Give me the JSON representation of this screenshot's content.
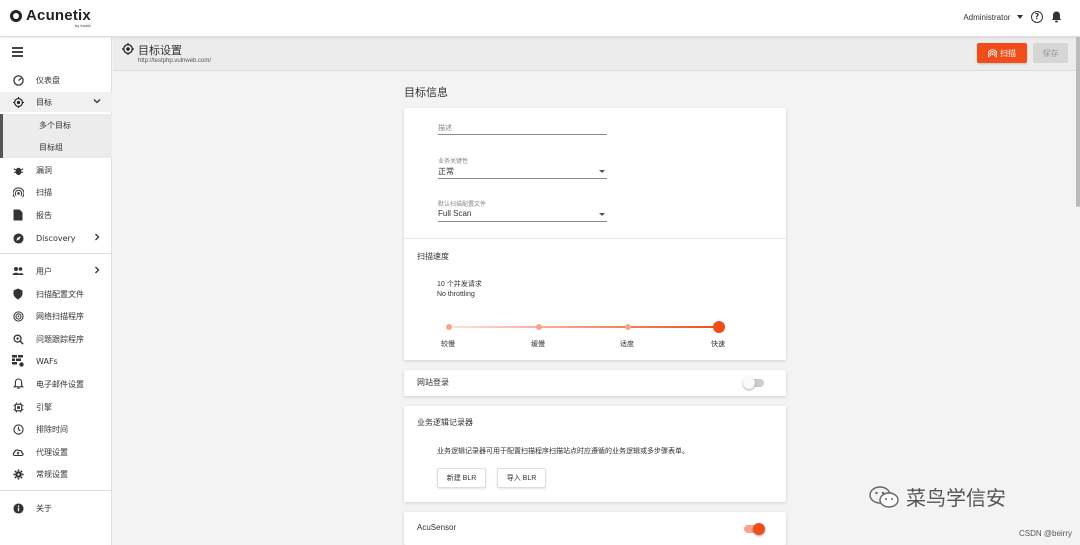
{
  "app": {
    "name": "Acunetix",
    "byline": "by Invicti"
  },
  "header": {
    "user": "Administrator"
  },
  "sidebar": {
    "items": [
      {
        "label": "仪表盘",
        "icon": "dashboard-icon"
      },
      {
        "label": "目标",
        "icon": "target-icon"
      },
      {
        "label": "漏洞",
        "icon": "bug-icon"
      },
      {
        "label": "扫描",
        "icon": "scan-icon"
      },
      {
        "label": "报告",
        "icon": "report-icon"
      },
      {
        "label": "Discovery",
        "icon": "compass-icon"
      },
      {
        "label": "用户",
        "icon": "users-icon"
      },
      {
        "label": "扫描配置文件",
        "icon": "shield-icon"
      },
      {
        "label": "网络扫描程序",
        "icon": "network-scanner-icon"
      },
      {
        "label": "问题跟踪程序",
        "icon": "issue-tracker-icon"
      },
      {
        "label": "WAFs",
        "icon": "waf-icon"
      },
      {
        "label": "电子邮件设置",
        "icon": "bell-icon"
      },
      {
        "label": "引擎",
        "icon": "engine-icon"
      },
      {
        "label": "排除时间",
        "icon": "clock-icon"
      },
      {
        "label": "代理设置",
        "icon": "cloud-icon"
      },
      {
        "label": "常规设置",
        "icon": "gear-icon"
      },
      {
        "label": "关于",
        "icon": "info-icon"
      }
    ],
    "subitems": [
      {
        "label": "多个目标"
      },
      {
        "label": "目标组"
      }
    ]
  },
  "page": {
    "title": "目标设置",
    "url": "http://testphp.vulnweb.com/",
    "scan_label": "扫描",
    "save_label": "保存"
  },
  "target_info": {
    "section_title": "目标信息",
    "description_label": "描述",
    "criticality_label": "业务关键性",
    "criticality_value": "正常",
    "profile_label": "默认扫描配置文件",
    "profile_value": "Full Scan"
  },
  "scan_speed": {
    "label": "扫描速度",
    "requests_text": "10 个并发请求",
    "throttle_text": "No throttling",
    "levels": [
      "较慢",
      "缓慢",
      "适度",
      "快速"
    ],
    "selected_level": 3
  },
  "site_login": {
    "label": "网站登录",
    "enabled": false
  },
  "blr": {
    "title": "业务逻辑记录器",
    "description": "业务逻辑记录器可用于配置扫描程序扫描站点时应遵循的业务逻辑或多步骤表单。",
    "new_label": "新建 BLR",
    "import_label": "导入 BLR"
  },
  "acusensor": {
    "label": "AcuSensor",
    "enabled": true
  },
  "watermark": {
    "text": "菜鸟学信安"
  },
  "credit": {
    "text": "CSDN @beirry"
  },
  "colors": {
    "accent": "#f04d1a",
    "sidebar_bg": "#ffffff",
    "page_bg": "#f3f3f3"
  }
}
